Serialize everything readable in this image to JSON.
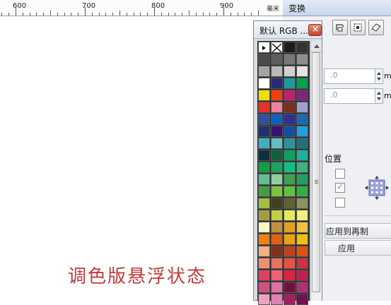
{
  "ruler": {
    "labels": [
      "600",
      "700",
      "800",
      "900"
    ],
    "unit": "毫米"
  },
  "docker": {
    "tab_title": "变换",
    "field1_value": ".0",
    "field2_value": ".0",
    "unit1": "m",
    "unit2": "m",
    "position_label": "位置",
    "apply_to_duplicate_label": "应用到再制",
    "apply_label": "应用"
  },
  "palette": {
    "title": "默认 RGB ...",
    "close_label": "×",
    "swatch_colors": [
      "#000000",
      "#ffffff",
      "#1b1b1b",
      "#333333",
      "#4a4a4a",
      "#5e5e5e",
      "#777777",
      "#8e8e8e",
      "#a4a4a4",
      "#b9b9b9",
      "#d0d0d0",
      "#e4e4e4",
      "#ffffff",
      "#2a2a7a",
      "#1a9aa0",
      "#00a050",
      "#f0e000",
      "#f04010",
      "#c02070",
      "#7a2878",
      "#e83028",
      "#f080a0",
      "#7a3020",
      "#a0a0d0",
      "#3050a0",
      "#1060c0",
      "#303090",
      "#1c6ab0",
      "#203070",
      "#3a1070",
      "#1050a0",
      "#20a0e0",
      "#40b0c0",
      "#60c0c0",
      "#3090a0",
      "#207080",
      "#103040",
      "#106040",
      "#10a060",
      "#20b0a0",
      "#10a040",
      "#20a060",
      "#10c080",
      "#40b080",
      "#60c090",
      "#90d0a0",
      "#40a050",
      "#20a060",
      "#40a040",
      "#80c040",
      "#60c040",
      "#30b040",
      "#a0c040",
      "#404020",
      "#606030",
      "#909060",
      "#a0a040",
      "#c0d040",
      "#e8e860",
      "#f0f080",
      "#f8f8c0",
      "#c09040",
      "#e0a020",
      "#f0c040",
      "#f08010",
      "#e06010",
      "#f0a010",
      "#f0c010",
      "#f0b080",
      "#803020",
      "#c04020",
      "#e05010",
      "#f09070",
      "#e87060",
      "#e85040",
      "#d03040",
      "#e04060",
      "#f06070",
      "#e02040",
      "#c02050",
      "#d05080",
      "#e070a0",
      "#701040",
      "#b03070",
      "#f0a0c0",
      "#e080b0",
      "#a02060",
      "#701050"
    ]
  },
  "canvas": {
    "caption": "调色版悬浮状态"
  }
}
